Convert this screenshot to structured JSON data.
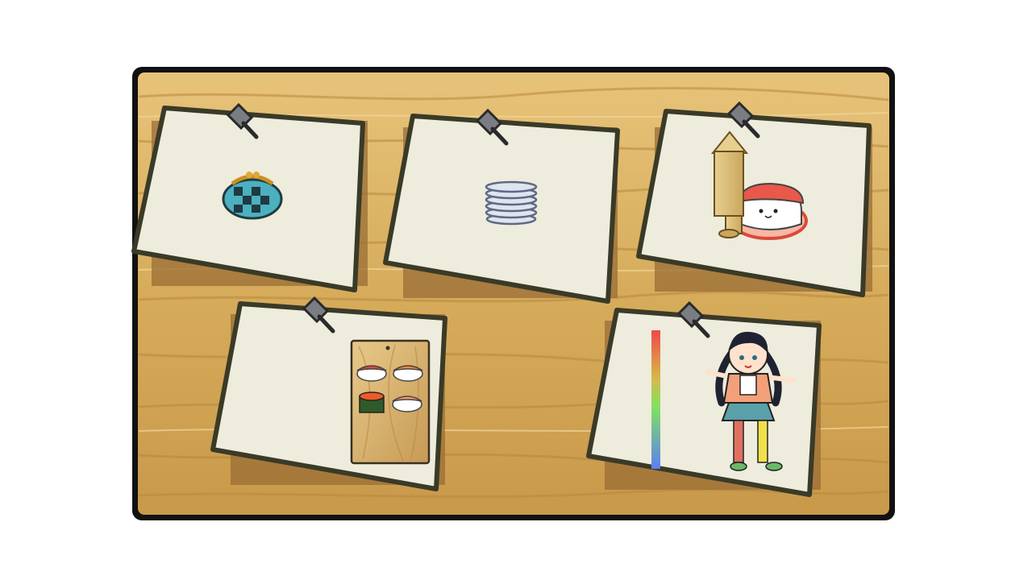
{
  "board": {
    "name": "wooden-corkboard",
    "colors": {
      "frame": "#111111",
      "wood_light": "#e0b86a",
      "wood_mid": "#c99a4a",
      "wood_dark": "#a87a35",
      "paper": "#eeecdc",
      "paper_outline": "#3a3a28",
      "shadow": "#9a6e35",
      "pin_metal": "#7a7d82"
    }
  },
  "notes": [
    {
      "id": "coin-purse",
      "item": "coin-purse-icon",
      "pinned": true
    },
    {
      "id": "plate-stack",
      "item": "plate-stack-icon",
      "pinned": true
    },
    {
      "id": "sushi-flag",
      "item": "sushi-with-sign-icon",
      "pinned": true
    },
    {
      "id": "sushi-menu",
      "item": "sushi-menu-board-icon",
      "pinned": true
    },
    {
      "id": "character",
      "item": "sushi-girl-character-icon",
      "pinned": true
    }
  ],
  "menu_board": {
    "items": [
      "tuna-nigiri-icon",
      "salmon-nigiri-icon",
      "ikura-gunkan-icon",
      "salmon-aburi-icon"
    ]
  },
  "gauge": {
    "colors": [
      "#ef4a4a",
      "#f2c24b",
      "#7fe360",
      "#5e7ff2"
    ]
  }
}
